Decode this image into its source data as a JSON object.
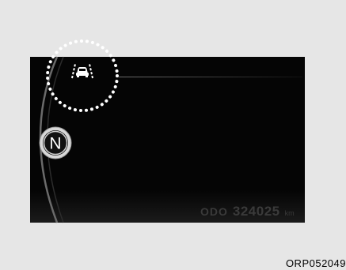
{
  "gear_indicator": {
    "label": "N"
  },
  "odometer": {
    "label": "ODO",
    "value": "324025",
    "unit": "km"
  },
  "image_code": "ORP052049",
  "icons": {
    "lane": "lane-keeping-assist-icon",
    "highlight": "dotted-highlight-circle"
  },
  "colors": {
    "background": "#e6e6e6",
    "display": "#050505",
    "highlight_dots": "#ffffff",
    "odometer_text": "#3a3a3a"
  }
}
